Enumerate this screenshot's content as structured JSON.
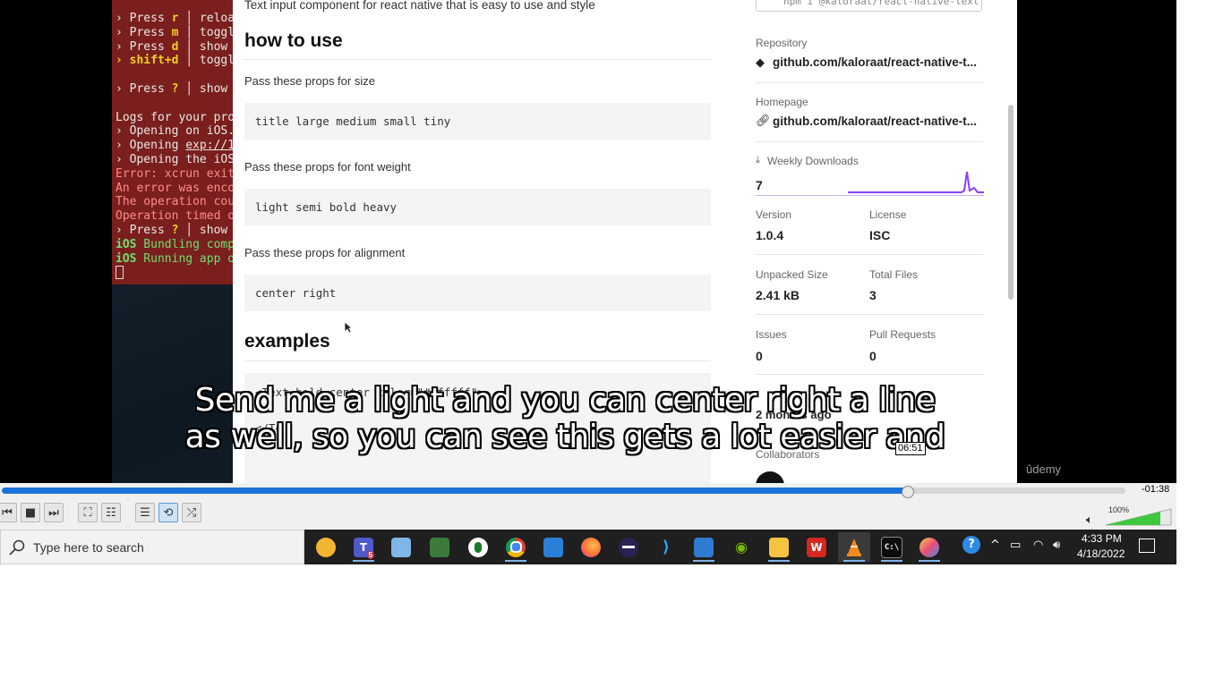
{
  "terminal": {
    "lines": [
      {
        "prefix": "› Press ",
        "key": "r",
        "rest": " │ reloa"
      },
      {
        "prefix": "› Press ",
        "key": "m",
        "rest": " │ toggl"
      },
      {
        "prefix": "› Press ",
        "key": "d",
        "rest": " │ show "
      },
      {
        "prefix": "› ",
        "key": "shift+d",
        "rest": " │ toggl"
      },
      {
        "prefix": "",
        "key": "",
        "rest": ""
      },
      {
        "prefix": "› Press ",
        "key": "?",
        "rest": " │ show "
      },
      {
        "prefix": "",
        "key": "",
        "rest": ""
      },
      {
        "prefix": "Logs for your pro",
        "key": "",
        "rest": ""
      },
      {
        "prefix": "› Opening on iOS.",
        "key": "",
        "rest": ""
      },
      {
        "prefix": "› Opening ",
        "key": "",
        "rest": "exp://1"
      },
      {
        "prefix": "› Opening the iOS",
        "key": "",
        "rest": ""
      },
      {
        "prefix": "Error: xcrun exit",
        "key": "",
        "rest": ""
      },
      {
        "prefix": "An error was enco",
        "key": "",
        "rest": ""
      },
      {
        "prefix": "The operation cou",
        "key": "",
        "rest": ""
      },
      {
        "prefix": "Operation timed o",
        "key": "",
        "rest": ""
      },
      {
        "prefix": "› Press ",
        "key": "?",
        "rest": " │ show "
      },
      {
        "prefix": "iOS",
        "key": "",
        "rest": " Bundling comp"
      },
      {
        "prefix": "iOS",
        "key": "",
        "rest": " Running app o"
      }
    ]
  },
  "npm_page": {
    "description": "Text input component for react native that is easy to use and style",
    "how_to_use_heading": "how to use",
    "size_label": "Pass these props for size",
    "size_code": "title large medium small tiny",
    "weight_label": "Pass these props for font weight",
    "weight_code": "light semi bold heavy",
    "align_label": "Pass these props for alignment",
    "align_code": "center right",
    "examples_heading": "examples",
    "example_code_1": "<Text bold center color=\"#ffffff\">",
    "example_code_2": "</Te"
  },
  "sidebar": {
    "install_cmd": "npm i @kaloraat/react-native-text",
    "repository_label": "Repository",
    "repository_link": "github.com/kaloraat/react-native-t...",
    "homepage_label": "Homepage",
    "homepage_link": "github.com/kaloraat/react-native-t...",
    "weekly_downloads_label": "Weekly Downloads",
    "weekly_downloads": "7",
    "version_label": "Version",
    "version": "1.0.4",
    "license_label": "License",
    "license": "ISC",
    "unpacked_size_label": "Unpacked Size",
    "unpacked_size": "2.41 kB",
    "total_files_label": "Total Files",
    "total_files": "3",
    "issues_label": "Issues",
    "issues": "0",
    "pull_requests_label": "Pull Requests",
    "pull_requests": "0",
    "last_publish_value": "2 months ago",
    "collaborators_label": "Collaborators"
  },
  "video": {
    "watermark": "ûdemy",
    "subtitle_line_1": "Send me a light and you can center right a line",
    "subtitle_line_2": "as well, so you can see this gets a lot easier and",
    "hover_time": "06:51"
  },
  "player": {
    "progress": 0.804,
    "remaining": "-01:38",
    "volume_pct": "100%"
  },
  "taskbar": {
    "search_placeholder": "Type here to search",
    "teams_badge": "5",
    "clock_time": "4:33 PM",
    "clock_date": "4/18/2022"
  },
  "colors": {
    "accent": "#1a73d9",
    "terminal_bg": "#7a1f1d",
    "chart_line": "#8a3ffc",
    "volume_green": "#3ec83e"
  }
}
